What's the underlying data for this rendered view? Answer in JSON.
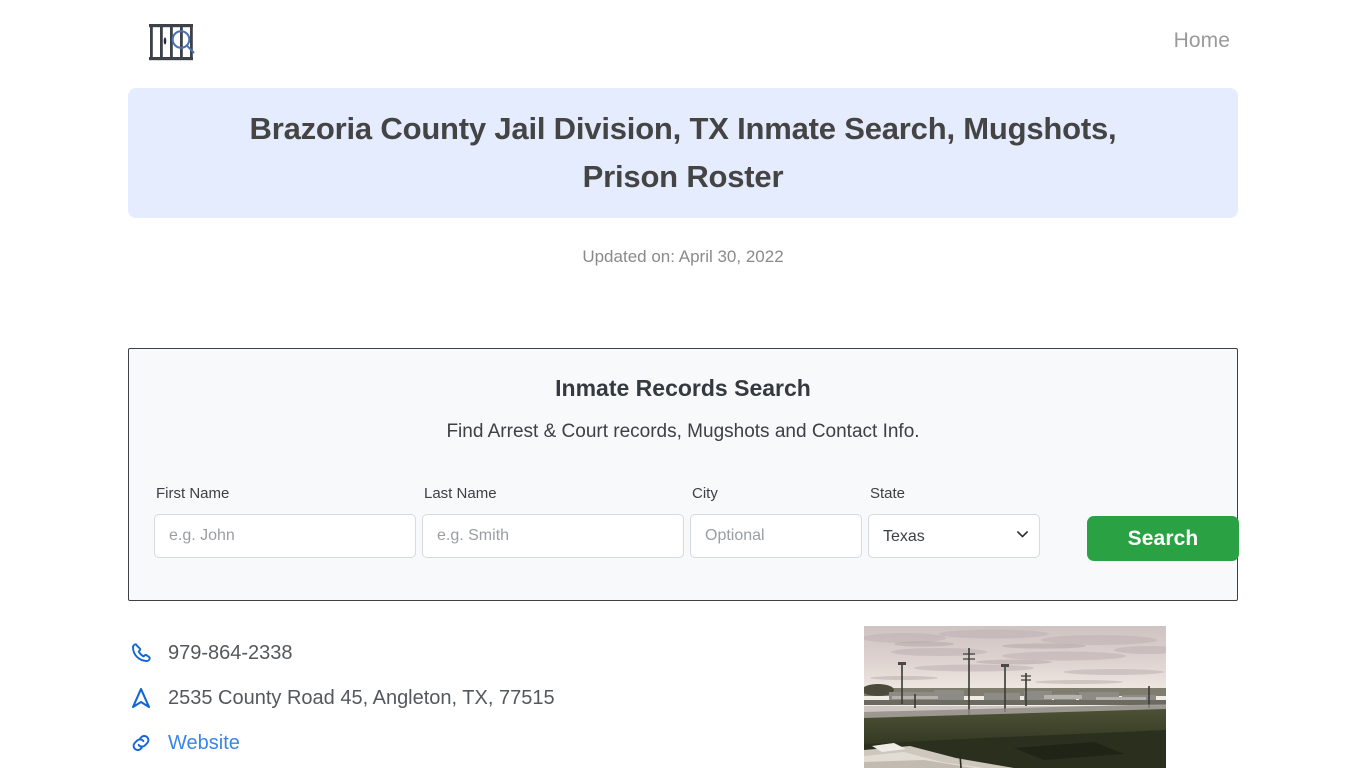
{
  "header": {
    "logo_alt": "jail-bars-magnifier-logo",
    "nav": [
      {
        "label": "Home",
        "name": "nav-home"
      }
    ]
  },
  "banner": {
    "title": "Brazoria County Jail Division, TX Inmate Search, Mugshots, Prison Roster",
    "bg_color": "#e4ecfd",
    "text_color": "#444444"
  },
  "updated": {
    "text": "Updated on: April 30, 2022"
  },
  "search_card": {
    "title": "Inmate Records Search",
    "subtitle": "Find Arrest & Court records, Mugshots and Contact Info.",
    "fields": {
      "first_name": {
        "label": "First Name",
        "placeholder": "e.g. John",
        "value": ""
      },
      "last_name": {
        "label": "Last Name",
        "placeholder": "e.g. Smith",
        "value": ""
      },
      "city": {
        "label": "City",
        "placeholder": "Optional",
        "value": ""
      },
      "state": {
        "label": "State",
        "selected": "Texas",
        "options": [
          "Texas"
        ]
      }
    },
    "submit_label": "Search",
    "submit_color": "#2aa244",
    "border_color": "#3f4044",
    "bg_color": "#f8f9fa"
  },
  "contact": {
    "phone": {
      "icon": "phone-icon",
      "text": "979-864-2338"
    },
    "address": {
      "icon": "navigation-arrow-icon",
      "text": "2535 County Road 45, Angleton, TX, 77515"
    },
    "website": {
      "icon": "link-icon",
      "text": "Website"
    },
    "icon_color": "#1266d6",
    "link_color": "#3a86e8"
  },
  "photo": {
    "alt": "facility-photo-brazoria-county-jail"
  }
}
